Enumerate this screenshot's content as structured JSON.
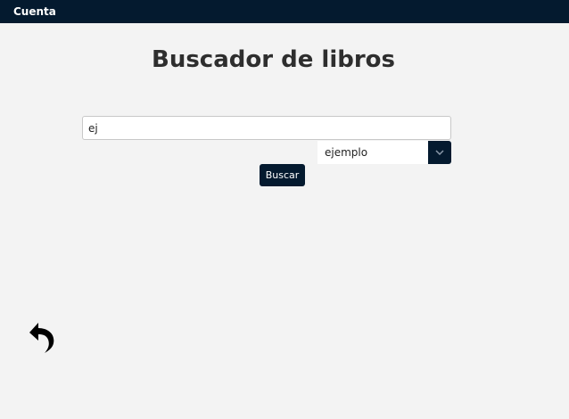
{
  "header": {
    "account_label": "Cuenta"
  },
  "main": {
    "title": "Buscador de libros",
    "search_value": "ej",
    "filter_selected": "ejemplo",
    "search_button_label": "Buscar"
  },
  "icons": {
    "dropdown": "chevron-down-icon",
    "back": "undo-arrow-icon"
  },
  "colors": {
    "brand_dark": "#041a2f",
    "background": "#f3f3f3"
  }
}
